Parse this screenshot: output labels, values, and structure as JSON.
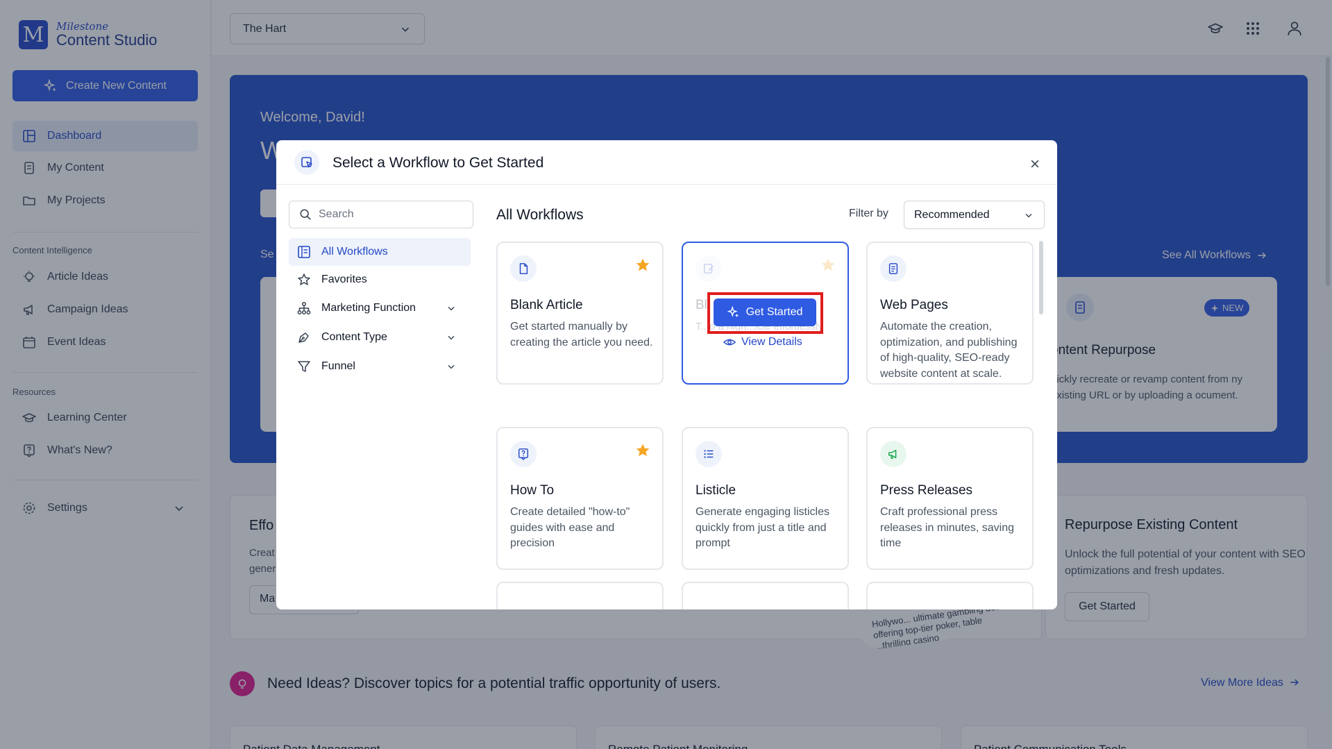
{
  "brand": {
    "small": "Milestone",
    "big": "Content Studio",
    "mark": "M"
  },
  "sidebar": {
    "create_label": "Create New Content",
    "items": [
      {
        "label": "Dashboard",
        "icon": "dashboard-icon"
      },
      {
        "label": "My Content",
        "icon": "document-icon"
      },
      {
        "label": "My Projects",
        "icon": "folder-icon"
      }
    ],
    "section_ci": "Content Intelligence",
    "ci_items": [
      {
        "label": "Article Ideas",
        "icon": "lightbulb-icon"
      },
      {
        "label": "Campaign Ideas",
        "icon": "megaphone-icon"
      },
      {
        "label": "Event Ideas",
        "icon": "calendar-icon"
      }
    ],
    "section_res": "Resources",
    "res_items": [
      {
        "label": "Learning Center",
        "icon": "graduation-cap-icon"
      },
      {
        "label": "What's New?",
        "icon": "question-bubble-icon"
      }
    ],
    "settings_label": "Settings"
  },
  "topbar": {
    "property": "The Hart"
  },
  "hero": {
    "welcome": "Welcome, David!",
    "heading_fragment": "W",
    "section_fragment": "Se",
    "see_all": "See All Workflows",
    "card": {
      "badge": "NEW",
      "title": "ontent Repurpose",
      "desc": "uickly recreate or revamp content from ny existing URL or by uploading a ocument."
    }
  },
  "lower": {
    "effortless_title": "Effo",
    "effortless_desc": "Creat gener",
    "effortless_btn": "Ma",
    "repurpose_title": "Repurpose Existing Content",
    "repurpose_desc": "Unlock the full potential of your content with SEO optimizations and fresh updates.",
    "repurpose_btn": "Get Started",
    "paper_text": "Hollywo... ultimate gambling des... offering top-tier poker, table ...thrilling casino"
  },
  "ideas": {
    "text": "Need Ideas? Discover topics for a potential traffic opportunity of users.",
    "link": "View More Ideas",
    "cards": [
      "Patient Data Management",
      "Remote Patient Monitoring",
      "Patient Communication Tools"
    ]
  },
  "modal": {
    "title": "Select a Workflow to Get Started",
    "search_placeholder": "Search",
    "nav": [
      {
        "label": "All Workflows",
        "icon": "list-icon",
        "active": true
      },
      {
        "label": "Favorites",
        "icon": "star-outline-icon"
      },
      {
        "label": "Marketing Function",
        "icon": "hierarchy-icon",
        "expandable": true
      },
      {
        "label": "Content Type",
        "icon": "pen-nib-icon",
        "expandable": true
      },
      {
        "label": "Funnel",
        "icon": "filter-icon",
        "expandable": true
      }
    ],
    "heading": "All Workflows",
    "filter_label": "Filter by",
    "filter_value": "Recommended",
    "cards": [
      {
        "title": "Blank Article",
        "desc": "Get started manually by creating the article you need.",
        "icon": "file-icon",
        "favorite": true
      },
      {
        "title": "Bl",
        "desc": "T...o a high...icle effortlessly",
        "icon": "edit-doc-icon",
        "favorite": true,
        "hover": true,
        "get_started": "Get Started",
        "view_details": "View Details"
      },
      {
        "title": "Web Pages",
        "desc": "Automate the creation, optimization, and publishing of high-quality, SEO-ready website content at scale.",
        "icon": "page-icon",
        "favorite": false
      },
      {
        "title": "How To",
        "desc": "Create detailed \"how-to\" guides with ease and precision",
        "icon": "help-doc-icon",
        "favorite": true
      },
      {
        "title": "Listicle",
        "desc": "Generate engaging listicles quickly from just a title and prompt",
        "icon": "bulleted-list-icon",
        "favorite": false
      },
      {
        "title": "Press Releases",
        "desc": "Craft professional press releases in minutes, saving time",
        "icon": "press-megaphone-icon",
        "favorite": false
      }
    ]
  },
  "colors": {
    "accent": "#2f5be3",
    "highlight_box": "#e11d1d",
    "star": "#f5a623"
  }
}
